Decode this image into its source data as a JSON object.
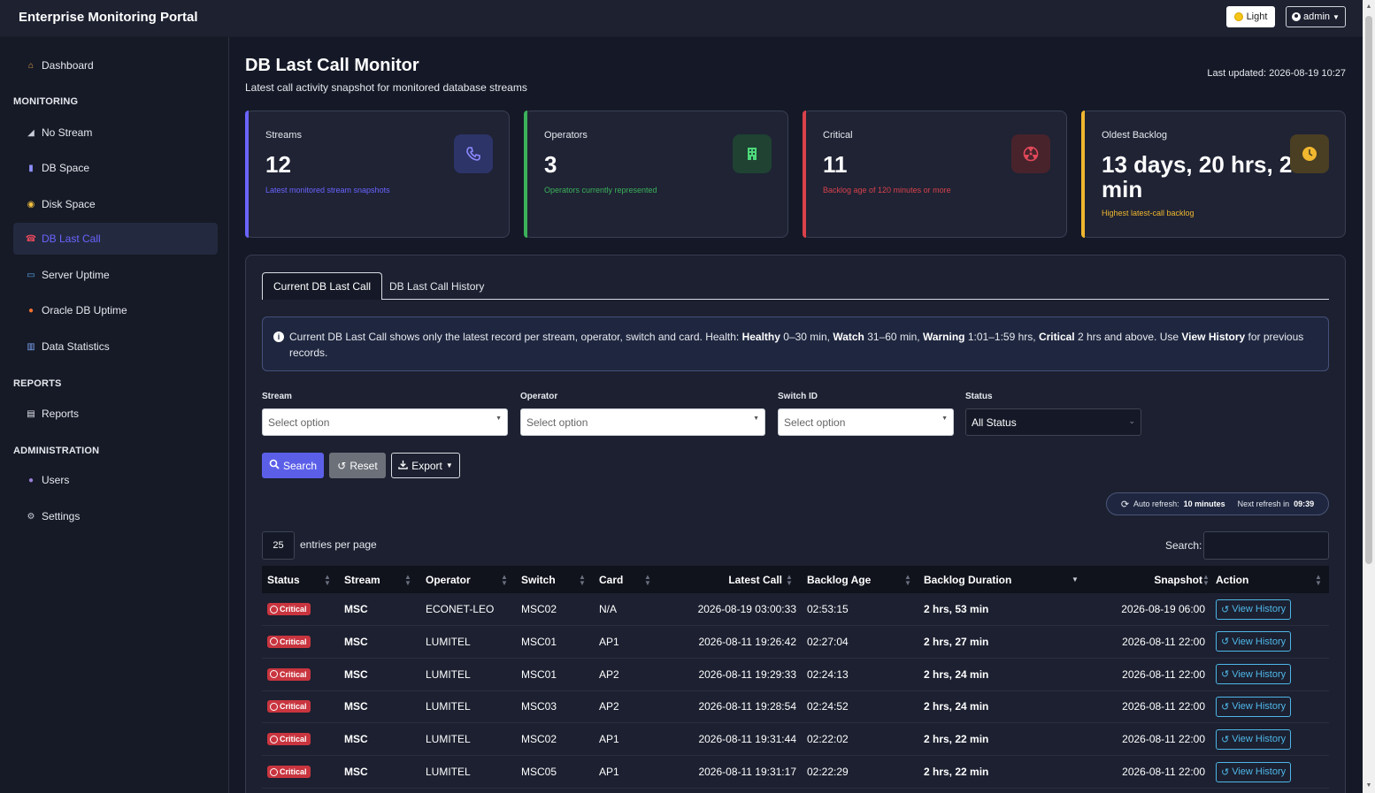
{
  "app": {
    "title": "Enterprise Monitoring Portal",
    "theme_toggle_label": "Light",
    "user_menu_label": "admin"
  },
  "sidebar": {
    "dashboard": "Dashboard",
    "sections": [
      "MONITORING",
      "REPORTS",
      "ADMINISTRATION"
    ],
    "monitoring_items": [
      "No Stream",
      "DB Space",
      "Disk Space",
      "DB Last Call",
      "Server Uptime",
      "Oracle DB Uptime",
      "Data Statistics"
    ],
    "reports_items": [
      "Reports"
    ],
    "admin_items": [
      "Users",
      "Settings"
    ],
    "active_item": "DB Last Call"
  },
  "page": {
    "title": "DB Last Call Monitor",
    "subtitle": "Latest call activity snapshot for monitored database streams",
    "last_updated": "Last updated: 2026-08-19 10:27"
  },
  "stats": [
    {
      "label": "Streams",
      "value": "12",
      "note": "Latest monitored stream snapshots",
      "accent": "#6a63ff",
      "icon": "phone-icon"
    },
    {
      "label": "Operators",
      "value": "3",
      "note": "Operators currently represented",
      "accent": "#3bb15a",
      "icon": "building-icon"
    },
    {
      "label": "Critical",
      "value": "11",
      "note": "Backlog age of 120 minutes or more",
      "accent": "#d9414b",
      "icon": "radiation-icon"
    },
    {
      "label": "Oldest Backlog",
      "value": "13 days, 20 hrs, 20 min",
      "note": "Highest latest-call backlog",
      "accent": "#f0b72f",
      "icon": "clock-icon"
    }
  ],
  "tabs": [
    "Current DB Last Call",
    "DB Last Call History"
  ],
  "info": {
    "t1": "Current DB Last Call shows only the latest record per stream, operator, switch and card. Health:",
    "healthy": "Healthy",
    "t2": "0–30 min,",
    "watch": "Watch",
    "t3": "31–60 min,",
    "warning": "Warning",
    "t4": "1:01–1:59 hrs,",
    "critical": "Critical",
    "t5": "2 hrs and above. Use",
    "view_history": "View History",
    "t6": "for previous records."
  },
  "filters": {
    "stream_label": "Stream",
    "operator_label": "Operator",
    "switch_label": "Switch ID",
    "status_label": "Status",
    "placeholder": "Select option",
    "status_value": "All Status"
  },
  "actions": {
    "search": "Search",
    "reset": "Reset",
    "export": "Export"
  },
  "refresh": {
    "label": "Auto refresh:",
    "interval": "10 minutes",
    "next_label": "Next refresh in",
    "next_value": "09:39"
  },
  "table_controls": {
    "per_page": "25",
    "per_page_label": "entries per page",
    "search_label": "Search:"
  },
  "table": {
    "columns": [
      "Status",
      "Stream",
      "Operator",
      "Switch",
      "Card",
      "Latest Call",
      "Backlog Age",
      "Backlog Duration",
      "Snapshot",
      "Action"
    ],
    "rows": [
      {
        "status": "Critical",
        "stream": "MSC",
        "operator": "ECONET-LEO",
        "switch": "MSC02",
        "card": "N/A",
        "latest_call": "2026-08-19 03:00:33",
        "backlog_age": "02:53:15",
        "duration": "2 hrs, 53 min",
        "snapshot": "2026-08-19 06:00",
        "action": "View History"
      },
      {
        "status": "Critical",
        "stream": "MSC",
        "operator": "LUMITEL",
        "switch": "MSC01",
        "card": "AP1",
        "latest_call": "2026-08-11 19:26:42",
        "backlog_age": "02:27:04",
        "duration": "2 hrs, 27 min",
        "snapshot": "2026-08-11 22:00",
        "action": "View History"
      },
      {
        "status": "Critical",
        "stream": "MSC",
        "operator": "LUMITEL",
        "switch": "MSC01",
        "card": "AP2",
        "latest_call": "2026-08-11 19:29:33",
        "backlog_age": "02:24:13",
        "duration": "2 hrs, 24 min",
        "snapshot": "2026-08-11 22:00",
        "action": "View History"
      },
      {
        "status": "Critical",
        "stream": "MSC",
        "operator": "LUMITEL",
        "switch": "MSC03",
        "card": "AP2",
        "latest_call": "2026-08-11 19:28:54",
        "backlog_age": "02:24:52",
        "duration": "2 hrs, 24 min",
        "snapshot": "2026-08-11 22:00",
        "action": "View History"
      },
      {
        "status": "Critical",
        "stream": "MSC",
        "operator": "LUMITEL",
        "switch": "MSC02",
        "card": "AP1",
        "latest_call": "2026-08-11 19:31:44",
        "backlog_age": "02:22:02",
        "duration": "2 hrs, 22 min",
        "snapshot": "2026-08-11 22:00",
        "action": "View History"
      },
      {
        "status": "Critical",
        "stream": "MSC",
        "operator": "LUMITEL",
        "switch": "MSC05",
        "card": "AP1",
        "latest_call": "2026-08-11 19:31:17",
        "backlog_age": "02:22:29",
        "duration": "2 hrs, 22 min",
        "snapshot": "2026-08-11 22:00",
        "action": "View History"
      }
    ]
  }
}
